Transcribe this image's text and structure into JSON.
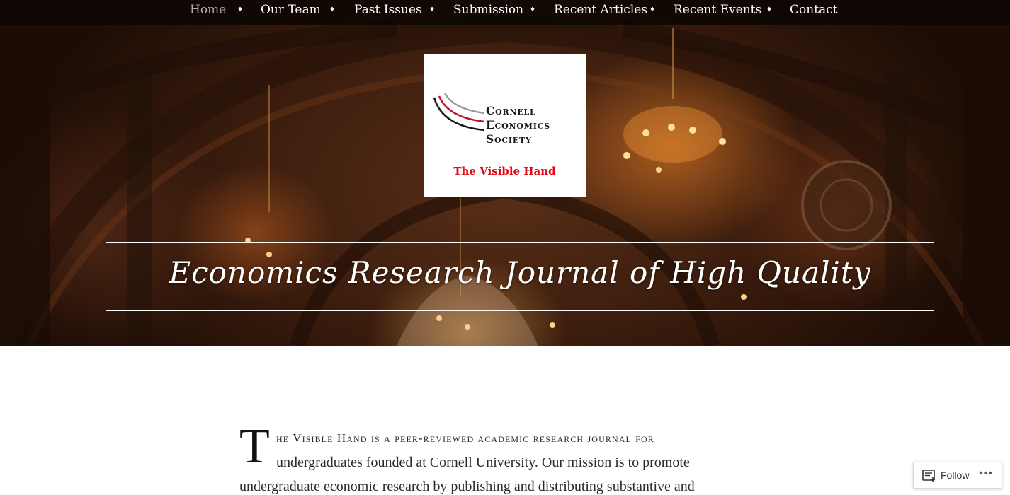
{
  "nav": {
    "items": [
      {
        "label": "Home",
        "active": true
      },
      {
        "label": "Our Team"
      },
      {
        "label": "Past Issues"
      },
      {
        "label": "Submission"
      },
      {
        "label": "Recent Articles"
      },
      {
        "label": "Recent Events"
      },
      {
        "label": "Contact"
      }
    ],
    "separator": "♦"
  },
  "logo": {
    "line1": "Cornell",
    "line2": "Economics",
    "line3": "Society",
    "tagline": "The Visible Hand",
    "arc_colors": [
      "#9a9a9a",
      "#c8102e",
      "#1a1a1a"
    ],
    "tagline_color": "#e30613"
  },
  "hero": {
    "headline": "Economics Research Journal of High Quality"
  },
  "intro": {
    "dropcap": "T",
    "line1": "he Visible Hand is a peer-reviewed academic research journal for",
    "line2": "undergraduates founded at Cornell University. Our mission is to promote",
    "line3": "undergraduate economic research by publishing and distributing substantive and"
  },
  "follow": {
    "label": "Follow",
    "icon": "follow-reader-icon",
    "more": "•••"
  }
}
